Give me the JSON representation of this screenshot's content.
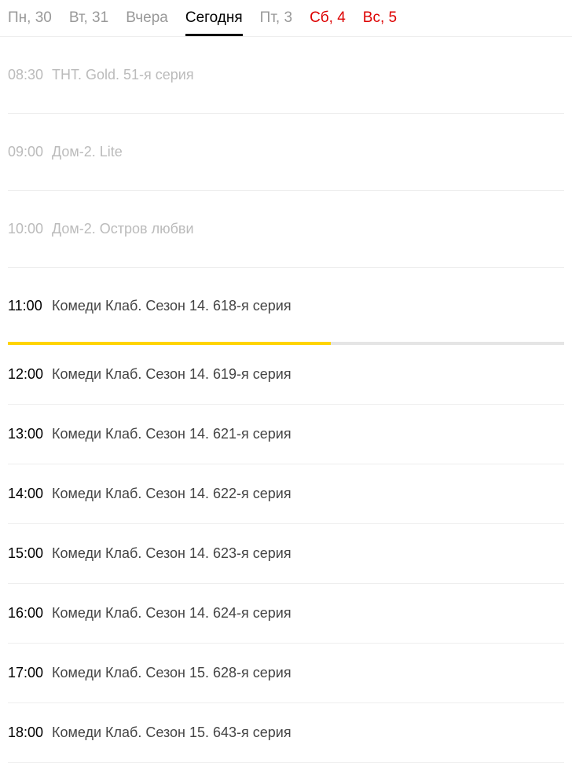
{
  "tabs": [
    {
      "label": "Пн, 30",
      "active": false,
      "weekend": false
    },
    {
      "label": "Вт, 31",
      "active": false,
      "weekend": false
    },
    {
      "label": "Вчера",
      "active": false,
      "weekend": false
    },
    {
      "label": "Сегодня",
      "active": true,
      "weekend": false
    },
    {
      "label": "Пт, 3",
      "active": false,
      "weekend": false
    },
    {
      "label": "Сб, 4",
      "active": false,
      "weekend": true
    },
    {
      "label": "Вс, 5",
      "active": false,
      "weekend": true
    }
  ],
  "schedule": [
    {
      "time": "08:30",
      "title": "ТНТ. Gold. 51-я серия",
      "past": true,
      "tall": true,
      "progress": null
    },
    {
      "time": "09:00",
      "title": "Дом-2. Lite",
      "past": true,
      "tall": true,
      "progress": null
    },
    {
      "time": "10:00",
      "title": "Дом-2. Остров любви",
      "past": true,
      "tall": true,
      "progress": null
    },
    {
      "time": "11:00",
      "title": "Комеди Клаб. Сезон 14. 618-я серия",
      "past": false,
      "tall": true,
      "progress": 58
    },
    {
      "time": "12:00",
      "title": "Комеди Клаб. Сезон 14. 619-я серия",
      "past": false,
      "tall": false,
      "progress": null
    },
    {
      "time": "13:00",
      "title": "Комеди Клаб. Сезон 14. 621-я серия",
      "past": false,
      "tall": false,
      "progress": null
    },
    {
      "time": "14:00",
      "title": "Комеди Клаб. Сезон 14. 622-я серия",
      "past": false,
      "tall": false,
      "progress": null
    },
    {
      "time": "15:00",
      "title": "Комеди Клаб. Сезон 14. 623-я серия",
      "past": false,
      "tall": false,
      "progress": null
    },
    {
      "time": "16:00",
      "title": "Комеди Клаб. Сезон 14. 624-я серия",
      "past": false,
      "tall": false,
      "progress": null
    },
    {
      "time": "17:00",
      "title": "Комеди Клаб. Сезон 15. 628-я серия",
      "past": false,
      "tall": false,
      "progress": null
    },
    {
      "time": "18:00",
      "title": "Комеди Клаб. Сезон 15. 643-я серия",
      "past": false,
      "tall": false,
      "progress": null
    }
  ]
}
